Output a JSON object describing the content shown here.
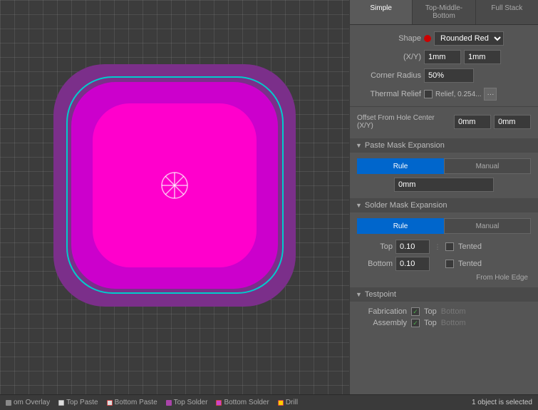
{
  "tabs": [
    {
      "label": "Simple",
      "active": true
    },
    {
      "label": "Top-Middle-Bottom",
      "active": false
    },
    {
      "label": "Full Stack",
      "active": false
    }
  ],
  "shape": {
    "label": "Shape",
    "value": "Rounded Red",
    "dot_color": "#cc0000"
  },
  "xy": {
    "x_value": "1mm",
    "y_value": "1mm"
  },
  "corner_radius": {
    "label": "Corner Radius",
    "value": "50%"
  },
  "thermal_relief": {
    "label": "Thermal Relief",
    "relief_text": "Relief, 0.254..."
  },
  "offset": {
    "label": "Offset From Hole Center (X/Y)",
    "x_value": "0mm",
    "y_value": "0mm"
  },
  "paste_mask": {
    "section_label": "Paste Mask Expansion",
    "rule_label": "Rule",
    "manual_label": "Manual",
    "value": "0mm"
  },
  "solder_mask": {
    "section_label": "Solder Mask Expansion",
    "rule_label": "Rule",
    "manual_label": "Manual",
    "top_label": "Top",
    "top_value": "0.10",
    "bottom_label": "Bottom",
    "bottom_value": "0.10",
    "tented_top": "Tented",
    "tented_bottom": "Tented",
    "from_hole_edge": "From Hole Edge"
  },
  "testpoint": {
    "section_label": "Testpoint",
    "fabrication_label": "Fabrication",
    "fab_top_label": "Top",
    "fab_bottom_label": "Bottom",
    "assembly_label": "Assembly",
    "asm_top_label": "Top",
    "asm_bottom_label": "Bottom"
  },
  "status_bar": {
    "layers": [
      {
        "label": "om Overlay",
        "color": "#888888"
      },
      {
        "label": "Top Paste",
        "color": "#cccccc",
        "border": "#aaaaaa"
      },
      {
        "label": "Bottom Paste",
        "color": "#cccccc",
        "border": "#cc4444"
      },
      {
        "label": "Top Solder",
        "color": "#aa44aa"
      },
      {
        "label": "Bottom Solder",
        "color": "#cc44cc",
        "border": "#cc4444"
      },
      {
        "label": "Drill",
        "color": "#ffcc00",
        "border": "#cc4444"
      }
    ],
    "status_text": "1 object is selected"
  }
}
